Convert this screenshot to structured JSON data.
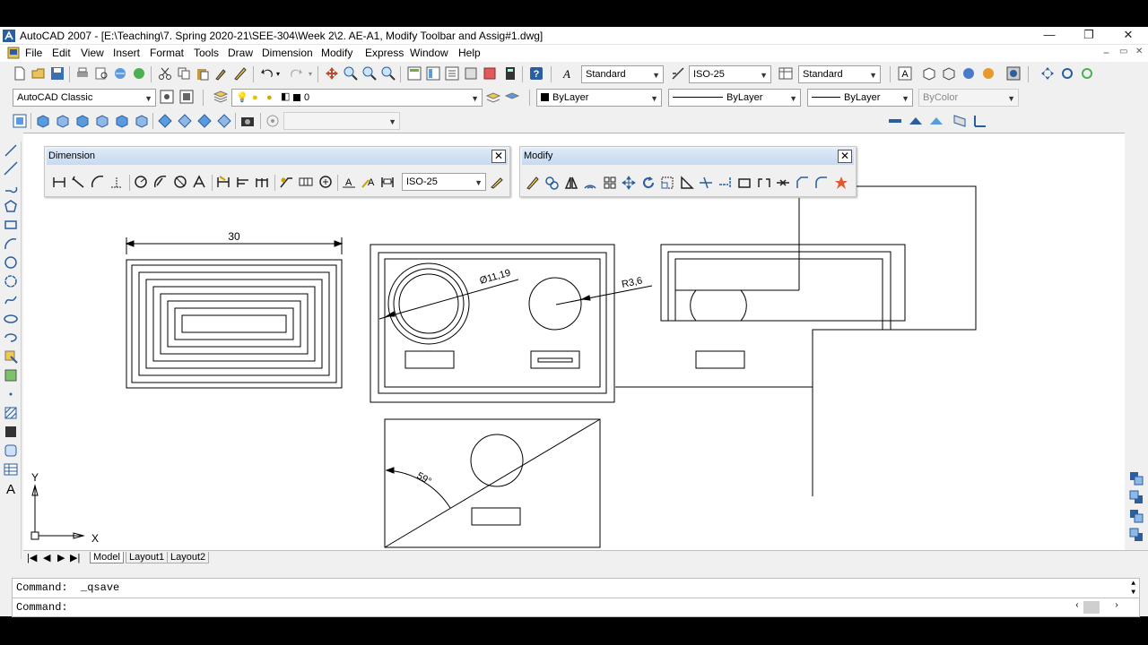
{
  "window": {
    "title": "AutoCAD 2007 - [E:\\Teaching\\7. Spring 2020-21\\SEE-304\\Week 2\\2. AE-A1, Modify Toolbar and Assig#1.dwg]",
    "minimize": "—",
    "restore": "❐",
    "close": "✕",
    "doc_minimize": "−",
    "doc_restore": "▭",
    "doc_close": "✕"
  },
  "menu": [
    "File",
    "Edit",
    "View",
    "Insert",
    "Format",
    "Tools",
    "Draw",
    "Dimension",
    "Modify",
    "Express",
    "Window",
    "Help"
  ],
  "toolbar": {
    "text_style": "Standard",
    "dim_style": "ISO-25",
    "table_style": "Standard",
    "workspace": "AutoCAD Classic",
    "layer": "0",
    "color": "ByLayer",
    "linetype": "ByLayer",
    "lineweight": "ByLayer",
    "plot_style": "ByColor"
  },
  "dimension_toolbar": {
    "title": "Dimension",
    "close": "✕",
    "style": "ISO-25"
  },
  "modify_toolbar": {
    "title": "Modify",
    "close": "✕"
  },
  "drawing": {
    "dim_linear": "30",
    "dim_diameter": "Ø11,19",
    "dim_radius": "R3,6",
    "dim_angle": "59°",
    "ucs_x": "X",
    "ucs_y": "Y"
  },
  "tabs": {
    "model": "Model",
    "layout1": "Layout1",
    "layout2": "Layout2"
  },
  "command": {
    "line1": "Command:  _qsave",
    "line2": "Command:"
  },
  "colors": {
    "accent": "#c7daf1",
    "canvas": "#ffffff",
    "chrome": "#f0f0f0"
  }
}
